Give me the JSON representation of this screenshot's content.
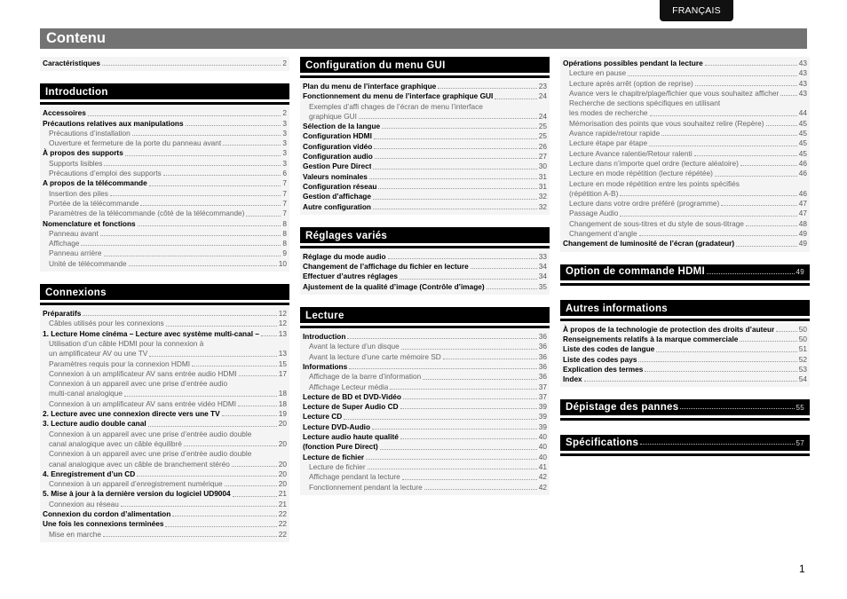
{
  "language_tab": "FRANÇAIS",
  "page_title": "Contenu",
  "page_number": "1",
  "columns": [
    {
      "blocks": [
        {
          "type": "plain",
          "entries": [
            {
              "level": 1,
              "text": "Caractéristiques",
              "page": "2"
            }
          ]
        },
        {
          "type": "section",
          "title": "Introduction",
          "entries": [
            {
              "level": 1,
              "text": "Accessoires",
              "page": "2"
            },
            {
              "level": 1,
              "text": "Précautions relatives aux manipulations",
              "page": "3"
            },
            {
              "level": 2,
              "text": "Précautions d’installation",
              "page": "3"
            },
            {
              "level": 2,
              "text": "Ouverture et fermeture de la porte du panneau avant",
              "page": "3"
            },
            {
              "level": 1,
              "text": "À propos des supports",
              "page": "3"
            },
            {
              "level": 2,
              "text": "Supports lisibles",
              "page": "3"
            },
            {
              "level": 2,
              "text": "Précautions d’emploi des supports",
              "page": "6"
            },
            {
              "level": 1,
              "text": "A propos de la télécommande",
              "page": "7"
            },
            {
              "level": 2,
              "text": "Insertion des piles",
              "page": "7"
            },
            {
              "level": 2,
              "text": "Portée de la télécommande",
              "page": "7"
            },
            {
              "level": 2,
              "text": "Paramètres de la télécommande (côté de la télécommande)",
              "page": "7"
            },
            {
              "level": 1,
              "text": "Nomenclature et fonctions",
              "page": "8"
            },
            {
              "level": 2,
              "text": "Panneau avant",
              "page": "8"
            },
            {
              "level": 2,
              "text": "Affichage",
              "page": "8"
            },
            {
              "level": 2,
              "text": "Panneau arrière",
              "page": "9"
            },
            {
              "level": 2,
              "text": "Unité de télécommande",
              "page": "10"
            }
          ]
        },
        {
          "type": "section",
          "title": "Connexions",
          "entries": [
            {
              "level": 1,
              "text": "Préparatifs",
              "page": "12"
            },
            {
              "level": 2,
              "text": "Câbles utilisés pour les connexions",
              "page": "12"
            },
            {
              "level": 1,
              "text": "1. Lecture Home cinéma – Lecture avec système multi-canal –",
              "page": "13"
            },
            {
              "level": 2,
              "text": "Utilisation d’un câble HDMI pour la connexion à",
              "page": ""
            },
            {
              "level": 2,
              "text": "un amplificateur AV ou une TV",
              "page": "13"
            },
            {
              "level": 2,
              "text": "Paramètres requis pour la connexion HDMI",
              "page": "15"
            },
            {
              "level": 2,
              "text": "Connexion à un amplificateur AV sans entrée audio HDMI",
              "page": "17"
            },
            {
              "level": 2,
              "text": "Connexion à un appareil avec une prise d’entrée audio",
              "page": ""
            },
            {
              "level": 2,
              "text": "multi-canal analogique",
              "page": "18"
            },
            {
              "level": 2,
              "text": "Connexion à un amplificateur AV sans entrée vidéo HDMI",
              "page": "18"
            },
            {
              "level": 1,
              "text": "2. Lecture avec une connexion directe vers une TV",
              "page": "19"
            },
            {
              "level": 1,
              "text": "3. Lecture audio double canal",
              "page": "20"
            },
            {
              "level": 2,
              "text": "Connexion à un appareil avec une prise d’entrée audio double",
              "page": ""
            },
            {
              "level": 2,
              "text": "canal analogique avec un câble équilibré",
              "page": "20"
            },
            {
              "level": 2,
              "text": "Connexion à un appareil avec une prise d’entrée audio double",
              "page": ""
            },
            {
              "level": 2,
              "text": "canal analogique avec un câble de branchement stéréo",
              "page": "20"
            },
            {
              "level": 1,
              "text": "4. Enregistrement d’un CD",
              "page": "20"
            },
            {
              "level": 2,
              "text": "Connexion à un appareil d’enregistrement numérique",
              "page": "20"
            },
            {
              "level": 1,
              "text": "5. Mise à jour à la dernière version du logiciel UD9004",
              "page": "21"
            },
            {
              "level": 2,
              "text": "Connexion au réseau",
              "page": "21"
            },
            {
              "level": 1,
              "text": "Connexion du cordon d’alimentation",
              "page": "22"
            },
            {
              "level": 1,
              "text": "Une fois les connexions terminées",
              "page": "22"
            },
            {
              "level": 2,
              "text": "Mise en marche",
              "page": "22"
            }
          ]
        }
      ]
    },
    {
      "blocks": [
        {
          "type": "section",
          "title": "Configuration du menu GUI",
          "entries": [
            {
              "level": 1,
              "text": "Plan du menu de l’interface graphique",
              "page": "23"
            },
            {
              "level": 1,
              "text": "Fonctionnement du menu de l’interface graphique GUI",
              "page": "24"
            },
            {
              "level": 2,
              "text": "Exemples d’affi chages de l’écran de menu l’interface",
              "page": ""
            },
            {
              "level": 2,
              "text": "graphique GUI",
              "page": "24"
            },
            {
              "level": 1,
              "text": "Sélection de la langue",
              "page": "25"
            },
            {
              "level": 1,
              "text": "Configuration HDMI",
              "page": "25"
            },
            {
              "level": 1,
              "text": "Configuration vidéo",
              "page": "26"
            },
            {
              "level": 1,
              "text": "Configuration audio",
              "page": "27"
            },
            {
              "level": 1,
              "text": "Gestion Pure Direct",
              "page": "30"
            },
            {
              "level": 1,
              "text": "Valeurs nominales",
              "page": "31"
            },
            {
              "level": 1,
              "text": "Configuration réseau",
              "page": "31"
            },
            {
              "level": 1,
              "text": "Gestion d’affichage",
              "page": "32"
            },
            {
              "level": 1,
              "text": "Autre configuration",
              "page": "32"
            }
          ]
        },
        {
          "type": "section",
          "title": "Réglages variés",
          "entries": [
            {
              "level": 1,
              "text": "Réglage du mode audio",
              "page": "33"
            },
            {
              "level": 1,
              "text": "Changement de l’affichage du fichier en lecture",
              "page": "34"
            },
            {
              "level": 1,
              "text": "Effectuer d’autres réglages",
              "page": "34"
            },
            {
              "level": 1,
              "text": "Ajustement de la qualité d’image (Contrôle d’image)",
              "page": "35"
            }
          ]
        },
        {
          "type": "section",
          "title": "Lecture",
          "entries": [
            {
              "level": 1,
              "text": "Introduction",
              "page": "36"
            },
            {
              "level": 2,
              "text": "Avant la lecture d’un disque",
              "page": "36"
            },
            {
              "level": 2,
              "text": "Avant la lecture d’une carte mémoire SD",
              "page": "36"
            },
            {
              "level": 1,
              "text": "Informations",
              "page": "36"
            },
            {
              "level": 2,
              "text": "Affichage de la barre d’information",
              "page": "36"
            },
            {
              "level": 2,
              "text": "Affichage Lecteur média",
              "page": "37"
            },
            {
              "level": 1,
              "text": "Lecture de BD et DVD-Vidéo",
              "page": "37"
            },
            {
              "level": 1,
              "text": "Lecture de Super Audio CD",
              "page": "39"
            },
            {
              "level": 1,
              "text": "Lecture CD",
              "page": "39"
            },
            {
              "level": 1,
              "text": "Lecture DVD-Audio",
              "page": "39"
            },
            {
              "level": 1,
              "text": "Lecture audio haute qualité",
              "page": "40"
            },
            {
              "level": 1,
              "text": "(fonction Pure Direct)",
              "page": "40"
            },
            {
              "level": 1,
              "text": "Lecture de fichier",
              "page": "40"
            },
            {
              "level": 2,
              "text": "Lecture de fichier",
              "page": "41"
            },
            {
              "level": 2,
              "text": "Affichage pendant la lecture",
              "page": "42"
            },
            {
              "level": 2,
              "text": "Fonctionnement pendant la lecture",
              "page": "42"
            }
          ]
        }
      ]
    },
    {
      "blocks": [
        {
          "type": "plain",
          "entries": [
            {
              "level": 1,
              "text": "Opérations possibles pendant la lecture",
              "page": "43"
            },
            {
              "level": 2,
              "text": "Lecture en pause",
              "page": "43"
            },
            {
              "level": 2,
              "text": "Lecture après arrêt (option de reprise)",
              "page": "43"
            },
            {
              "level": 2,
              "text": "Avance vers le chapitre/plage/fichier que vous souhaitez afficher",
              "page": "43"
            },
            {
              "level": 2,
              "text": "Recherche de sections spécifiques en utilisant",
              "page": ""
            },
            {
              "level": 2,
              "text": "les modes de recherche",
              "page": "44"
            },
            {
              "level": 2,
              "text": "Mémorisation des points que vous souhaitez relire (Repère)",
              "page": "45"
            },
            {
              "level": 2,
              "text": "Avance rapide/retour rapide",
              "page": "45"
            },
            {
              "level": 2,
              "text": "Lecture étape par étape",
              "page": "45"
            },
            {
              "level": 2,
              "text": "Lecture Avance ralentie/Retour ralenti",
              "page": "45"
            },
            {
              "level": 2,
              "text": "Lecture dans n’importe quel ordre (lecture aléatoire)",
              "page": "46"
            },
            {
              "level": 2,
              "text": "Lecture en mode répétition (lecture répétée)",
              "page": "46"
            },
            {
              "level": 2,
              "text": "Lecture en mode répétition entre les points spécifiés",
              "page": ""
            },
            {
              "level": 2,
              "text": "(répétition A-B)",
              "page": "46"
            },
            {
              "level": 2,
              "text": "Lecture dans votre ordre préféré (programme)",
              "page": "47"
            },
            {
              "level": 2,
              "text": "Passage Audio",
              "page": "47"
            },
            {
              "level": 2,
              "text": "Changement de sous-titres et du style de sous-titrage",
              "page": "48"
            },
            {
              "level": 2,
              "text": "Changement d’angle",
              "page": "49"
            },
            {
              "level": 1,
              "text": "Changement de luminosité de l’écran (gradateur)",
              "page": "49"
            }
          ]
        },
        {
          "type": "big",
          "title": "Option de commande HDMI",
          "page": "49"
        },
        {
          "type": "section",
          "title": "Autres informations",
          "entries": [
            {
              "level": 1,
              "text": "À propos de la technologie de protection des droits d’auteur",
              "page": "50"
            },
            {
              "level": 1,
              "text": "Renseignements relatifs à la marque commerciale",
              "page": "50"
            },
            {
              "level": 1,
              "text": "Liste des codes de langue",
              "page": "51"
            },
            {
              "level": 1,
              "text": "Liste des codes pays",
              "page": "52"
            },
            {
              "level": 1,
              "text": "Explication des termes",
              "page": "53"
            },
            {
              "level": 1,
              "text": "Index",
              "page": "54"
            }
          ]
        },
        {
          "type": "big",
          "title": "Dépistage des pannes",
          "page": "55"
        },
        {
          "type": "big",
          "title": "Spécifications",
          "page": "57"
        }
      ]
    }
  ]
}
